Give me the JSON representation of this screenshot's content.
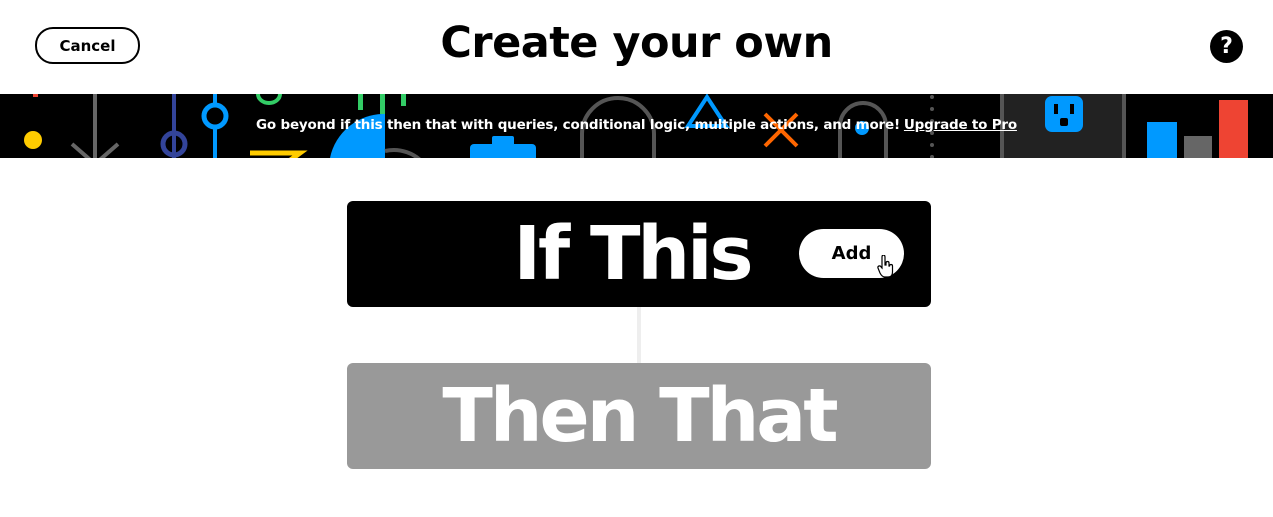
{
  "header": {
    "cancel_label": "Cancel",
    "title": "Create your own",
    "help_label": "?"
  },
  "banner": {
    "text": "Go beyond if this then that with queries, conditional logic, multiple actions, and more!",
    "link_label": "Upgrade to Pro",
    "background_color": "#000000",
    "decorations": [
      "arrow-down-icon",
      "slider-icon",
      "camera-icon",
      "triangle-icon",
      "x-icon",
      "outlet-icon",
      "bar-chart-icon"
    ]
  },
  "if_block": {
    "label": "If This",
    "add_label": "Add",
    "background_color": "#000000"
  },
  "then_block": {
    "label": "Then That",
    "background_color": "#999999"
  },
  "colors": {
    "blue": "#0099ff",
    "orange": "#ff6600",
    "yellow": "#ffcc00",
    "green": "#33cc66",
    "red": "#ee4433"
  }
}
